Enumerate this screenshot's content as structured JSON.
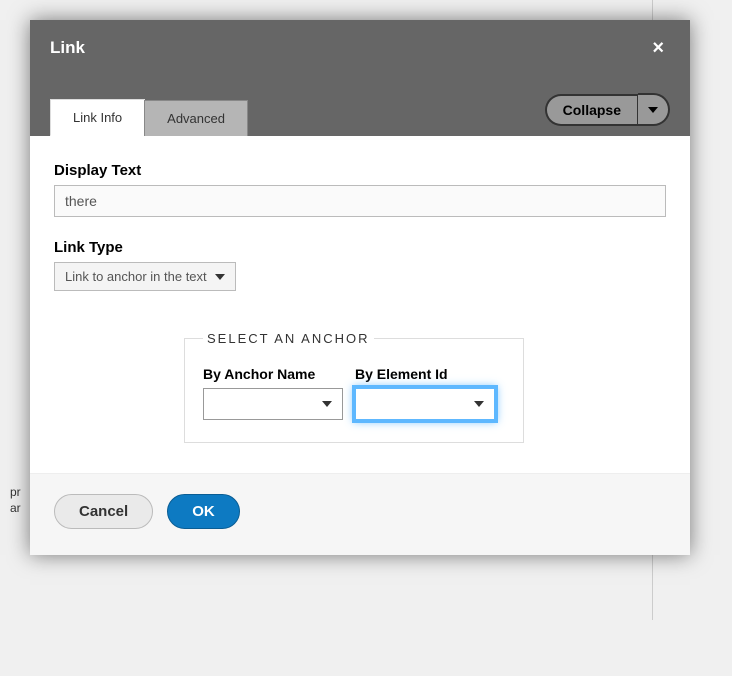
{
  "background": {
    "snippet_left": "pr\nar"
  },
  "dialog": {
    "title": "Link",
    "close_icon": "×",
    "tabs": {
      "link_info": "Link Info",
      "advanced": "Advanced"
    },
    "collapse": "Collapse",
    "fields": {
      "display_text_label": "Display Text",
      "display_text_value": "there",
      "link_type_label": "Link Type",
      "link_type_value": "Link to anchor in the text"
    },
    "anchor": {
      "legend": "Select an anchor",
      "by_name_label": "By Anchor Name",
      "by_id_label": "By Element Id",
      "by_name_value": "",
      "by_id_value": ""
    },
    "buttons": {
      "cancel": "Cancel",
      "ok": "OK"
    }
  }
}
